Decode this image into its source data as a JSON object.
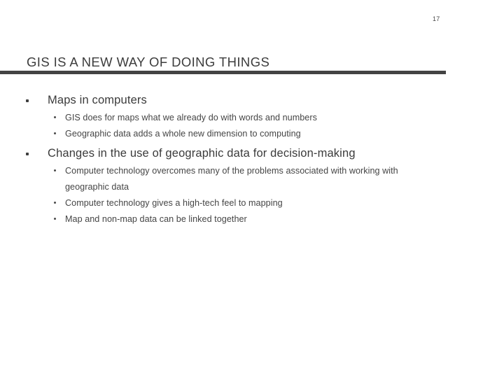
{
  "slide": {
    "page_number": "17",
    "title": "GIS IS A NEW WAY OF DOING THINGS",
    "accent_color": "#434343",
    "text_color": "#3b3b3b",
    "background_color": "#ffffff",
    "bullets": [
      {
        "marker": "square-bullet",
        "text": "Maps in computers",
        "sub_bullets": [
          {
            "marker": "dot-bullet",
            "text": "GIS does for maps what we already do with words and numbers"
          },
          {
            "marker": "dot-bullet",
            "text": "Geographic data adds a whole new dimension to computing"
          }
        ]
      },
      {
        "marker": "square-bullet",
        "text": "Changes in the use of geographic data for decision-making",
        "sub_bullets": [
          {
            "marker": "dot-bullet",
            "text": "Computer technology overcomes many of the problems associated with working with geographic data"
          },
          {
            "marker": "dot-bullet",
            "text": "Computer technology gives a high-tech feel to mapping"
          },
          {
            "marker": "dot-bullet",
            "text": "Map and non-map data can be linked together"
          }
        ]
      }
    ]
  }
}
